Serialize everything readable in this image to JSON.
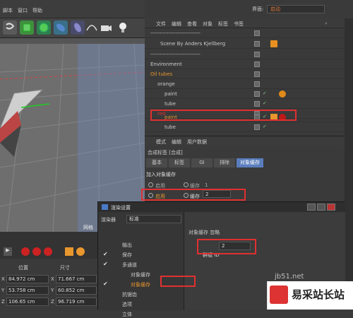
{
  "menubar": {
    "items": [
      "脚本",
      "窗口",
      "帮助"
    ]
  },
  "toolbar": {
    "icons": [
      "script-icon",
      "cube-icon",
      "gear-icon",
      "flower-icon",
      "capsule-icon",
      "spline-icon",
      "camera-icon",
      "light-icon"
    ]
  },
  "interface": {
    "label": "界面:",
    "value": "启动"
  },
  "object_manager": {
    "menu": [
      "文件",
      "编辑",
      "查看",
      "对象",
      "标签",
      "书签"
    ],
    "rows": [
      {
        "label": "----------------------------",
        "indent": 0
      },
      {
        "label": "Scene By Anders Kjellberg",
        "indent": 1
      },
      {
        "label": "----------------------------",
        "indent": 0
      },
      {
        "label": "Environment",
        "indent": 0
      },
      {
        "label": "Oil tubes",
        "indent": 0,
        "orange": true
      },
      {
        "label": "orange",
        "indent": 1
      },
      {
        "label": "paint",
        "indent": 2
      },
      {
        "label": "tube",
        "indent": 2
      },
      {
        "label": "red",
        "indent": 1
      },
      {
        "label": "paint",
        "indent": 2,
        "highlight": true
      },
      {
        "label": "tube",
        "indent": 2
      }
    ]
  },
  "attributes": {
    "menu": [
      "模式",
      "编辑",
      "用户数据"
    ],
    "title": "合成标签 [合成]",
    "tabs": [
      "基本",
      "标签",
      "GI",
      "排除",
      "对象缓存"
    ],
    "section": "加入对象缓存",
    "row1": {
      "enable": "启用",
      "cache": "缓存",
      "value": "1"
    },
    "row2": {
      "enable": "启用",
      "cache": "缓存",
      "value": "2"
    }
  },
  "dialog": {
    "title": "渲染设置",
    "renderer_label": "渲染器",
    "renderer_value": "标准",
    "right_header": "对象缓存 忽略",
    "group_id_label": "群组 ID",
    "group_id_value": "2",
    "items": [
      {
        "label": "输出",
        "check": false,
        "indent": 1
      },
      {
        "label": "保存",
        "check": true,
        "indent": 1
      },
      {
        "label": "多通道",
        "check": true,
        "indent": 1
      },
      {
        "label": "对象缓存",
        "check": false,
        "indent": 2
      },
      {
        "label": "对象缓存",
        "check": true,
        "indent": 2,
        "highlight": true
      },
      {
        "label": "抗锯齿",
        "check": false,
        "indent": 1
      },
      {
        "label": "选项",
        "check": false,
        "indent": 1
      },
      {
        "label": "立体",
        "check": false,
        "indent": 1
      }
    ]
  },
  "coords": {
    "headers": [
      "位置",
      "尺寸"
    ],
    "rows": [
      {
        "axis": "X",
        "pos": "84.972 cm",
        "saxis": "X",
        "size": "71.667 cm"
      },
      {
        "axis": "Y",
        "pos": "53.758 cm",
        "saxis": "Y",
        "size": "60.852 cm"
      },
      {
        "axis": "Z",
        "pos": "106.65 cm",
        "saxis": "Z",
        "size": "96.719 cm"
      }
    ]
  },
  "viewport": {
    "label": "网格"
  },
  "watermark": {
    "brand": "易采站长站",
    "site": "jb51.net"
  }
}
